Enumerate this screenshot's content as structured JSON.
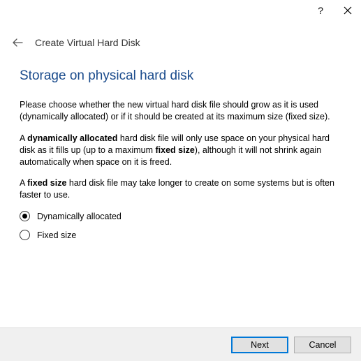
{
  "titlebar": {
    "help": "?",
    "close": "×"
  },
  "header": {
    "title": "Create Virtual Hard Disk"
  },
  "page": {
    "heading": "Storage on physical hard disk",
    "p1_a": "Please choose whether the new virtual hard disk file should grow as it is used (dynamically allocated) or if it should be created at its maximum size (fixed size).",
    "p2_a": "A ",
    "p2_b_bold": "dynamically allocated",
    "p2_c": " hard disk file will only use space on your physical hard disk as it fills up (up to a maximum ",
    "p2_d_bold": "fixed size",
    "p2_e": "), although it will not shrink again automatically when space on it is freed.",
    "p3_a": "A ",
    "p3_b_bold": "fixed size",
    "p3_c": " hard disk file may take longer to create on some systems but is often faster to use."
  },
  "options": {
    "dynamic": "Dynamically allocated",
    "fixed": "Fixed size"
  },
  "footer": {
    "next": "Next",
    "cancel": "Cancel"
  }
}
